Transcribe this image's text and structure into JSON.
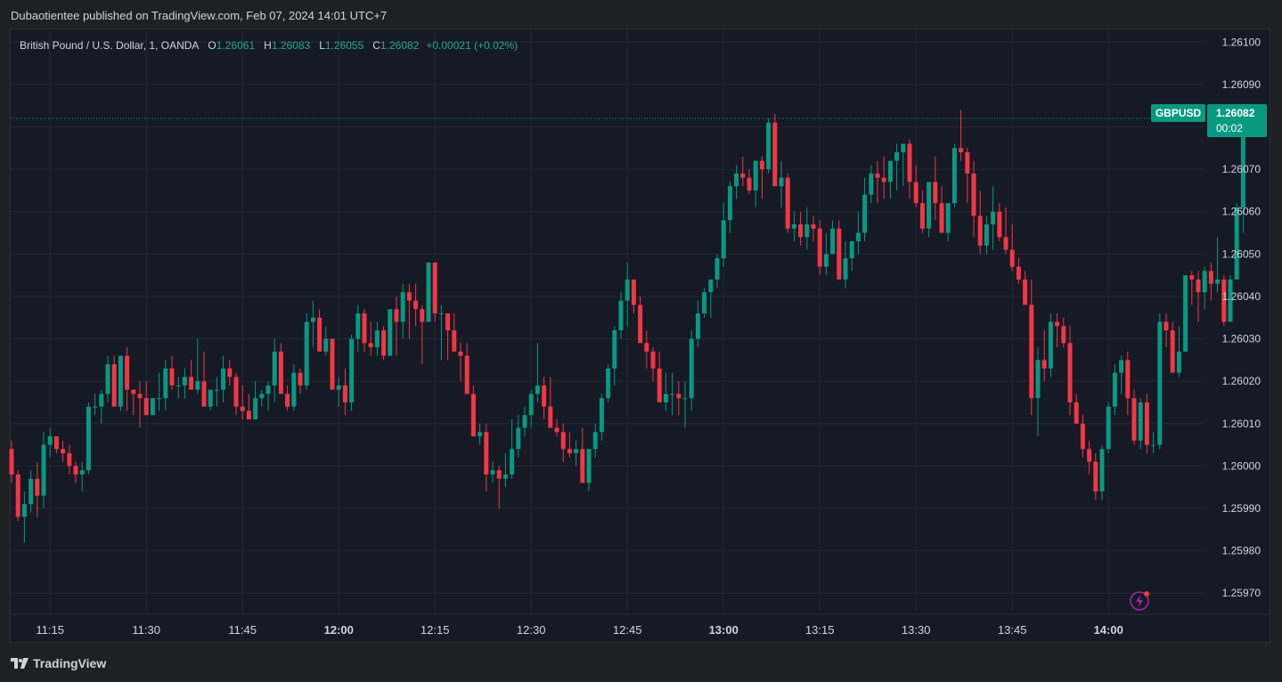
{
  "header": {
    "published": "Dubaotientee published on TradingView.com, Feb 07, 2024 14:01 UTC+7"
  },
  "legend": {
    "symbol": "British Pound / U.S. Dollar, 1, OANDA",
    "o_label": "O",
    "o_value": "1.26061",
    "h_label": "H",
    "h_value": "1.26083",
    "l_label": "L",
    "l_value": "1.26055",
    "c_label": "C",
    "c_value": "1.26082",
    "change": "+0.00021 (+0.02%)"
  },
  "price_tag": {
    "symbol": "GBPUSD",
    "price": "1.26082",
    "countdown": "00:02"
  },
  "footer": {
    "brand": "TradingView"
  },
  "colors": {
    "up": "#089981",
    "down": "#f23645",
    "grid": "#232733",
    "text": "#d1d4dc"
  },
  "icons": {
    "logo": "tradingview-logo-icon",
    "alert": "lightning-bolt-icon"
  },
  "chart_data": {
    "type": "candlestick",
    "y_axis": {
      "range": [
        1.25965,
        1.26103
      ],
      "ticks": [
        "1.26100",
        "1.26090",
        "1.26080",
        "1.26070",
        "1.26060",
        "1.26050",
        "1.26040",
        "1.26030",
        "1.26020",
        "1.26010",
        "1.26000",
        "1.25990",
        "1.25980",
        "1.25970"
      ]
    },
    "x_axis": {
      "ticks": [
        {
          "label": "11:15",
          "bold": false
        },
        {
          "label": "11:30",
          "bold": false
        },
        {
          "label": "11:45",
          "bold": false
        },
        {
          "label": "12:00",
          "bold": true
        },
        {
          "label": "12:15",
          "bold": false
        },
        {
          "label": "12:30",
          "bold": false
        },
        {
          "label": "12:45",
          "bold": false
        },
        {
          "label": "13:00",
          "bold": true
        },
        {
          "label": "13:15",
          "bold": false
        },
        {
          "label": "13:30",
          "bold": false
        },
        {
          "label": "13:45",
          "bold": false
        },
        {
          "label": "14:00",
          "bold": true
        }
      ],
      "start_time": "11:09",
      "end_time": "14:01"
    },
    "last_price": 1.26082,
    "ohlc": [
      [
        1.26004,
        1.26006,
        1.25996,
        1.25998
      ],
      [
        1.25998,
        1.25999,
        1.25987,
        1.25988
      ],
      [
        1.25988,
        1.25994,
        1.25982,
        1.25991
      ],
      [
        1.25991,
        1.25999,
        1.25989,
        1.25997
      ],
      [
        1.25997,
        1.26001,
        1.25988,
        1.25993
      ],
      [
        1.25993,
        1.26008,
        1.2599,
        1.26005
      ],
      [
        1.26005,
        1.26009,
        1.26002,
        1.26007
      ],
      [
        1.26007,
        1.26007,
        1.26003,
        1.26004
      ],
      [
        1.26004,
        1.26006,
        1.26001,
        1.26003
      ],
      [
        1.26003,
        1.26005,
        1.25998,
        1.26
      ],
      [
        1.26,
        1.26001,
        1.25996,
        1.25998
      ],
      [
        1.25998,
        1.26001,
        1.25994,
        1.25999
      ],
      [
        1.25999,
        1.26015,
        1.25998,
        1.26014
      ],
      [
        1.26014,
        1.26017,
        1.26012,
        1.26014
      ],
      [
        1.26014,
        1.26018,
        1.2601,
        1.26017
      ],
      [
        1.26017,
        1.26026,
        1.26015,
        1.26024
      ],
      [
        1.26024,
        1.26026,
        1.26016,
        1.26014
      ],
      [
        1.26014,
        1.26026,
        1.26013,
        1.26026
      ],
      [
        1.26026,
        1.26028,
        1.26013,
        1.26018
      ],
      [
        1.26018,
        1.26018,
        1.26012,
        1.26017
      ],
      [
        1.26017,
        1.2602,
        1.26009,
        1.26016
      ],
      [
        1.26016,
        1.2602,
        1.26012,
        1.26012
      ],
      [
        1.26012,
        1.26016,
        1.26012,
        1.26016
      ],
      [
        1.26016,
        1.26022,
        1.26013,
        1.26016
      ],
      [
        1.26016,
        1.26025,
        1.26013,
        1.26023
      ],
      [
        1.26023,
        1.26026,
        1.26018,
        1.26019
      ],
      [
        1.26019,
        1.26021,
        1.26016,
        1.26019
      ],
      [
        1.26019,
        1.26023,
        1.26016,
        1.26021
      ],
      [
        1.26021,
        1.26025,
        1.26018,
        1.26018
      ],
      [
        1.26018,
        1.2603,
        1.26017,
        1.2602
      ],
      [
        1.2602,
        1.26027,
        1.26016,
        1.26014
      ],
      [
        1.26014,
        1.26016,
        1.26013,
        1.26018
      ],
      [
        1.26018,
        1.26021,
        1.26014,
        1.26018
      ],
      [
        1.26018,
        1.26026,
        1.26015,
        1.26023
      ],
      [
        1.26023,
        1.26025,
        1.26019,
        1.26021
      ],
      [
        1.26021,
        1.26022,
        1.26012,
        1.26014
      ],
      [
        1.26014,
        1.26019,
        1.26011,
        1.26013
      ],
      [
        1.26013,
        1.26017,
        1.26011,
        1.26011
      ],
      [
        1.26011,
        1.2602,
        1.26011,
        1.26016
      ],
      [
        1.26016,
        1.26018,
        1.26014,
        1.26017
      ],
      [
        1.26017,
        1.2602,
        1.26013,
        1.26019
      ],
      [
        1.26019,
        1.2603,
        1.26015,
        1.26027
      ],
      [
        1.26027,
        1.26029,
        1.26018,
        1.26017
      ],
      [
        1.26017,
        1.26019,
        1.26013,
        1.26014
      ],
      [
        1.26014,
        1.26024,
        1.26013,
        1.26022
      ],
      [
        1.26022,
        1.26023,
        1.26017,
        1.26019
      ],
      [
        1.26019,
        1.26036,
        1.26018,
        1.26034
      ],
      [
        1.26034,
        1.26039,
        1.26028,
        1.26035
      ],
      [
        1.26035,
        1.26037,
        1.26028,
        1.26027
      ],
      [
        1.26027,
        1.26033,
        1.26026,
        1.2603
      ],
      [
        1.2603,
        1.2603,
        1.26018,
        1.26018
      ],
      [
        1.26018,
        1.26021,
        1.26014,
        1.26019
      ],
      [
        1.26019,
        1.26023,
        1.26012,
        1.26015
      ],
      [
        1.26015,
        1.26031,
        1.26013,
        1.2603
      ],
      [
        1.2603,
        1.26038,
        1.26027,
        1.26036
      ],
      [
        1.26036,
        1.26037,
        1.26027,
        1.26029
      ],
      [
        1.26029,
        1.26034,
        1.26026,
        1.26028
      ],
      [
        1.26028,
        1.26034,
        1.26026,
        1.26032
      ],
      [
        1.26032,
        1.26033,
        1.26025,
        1.26026
      ],
      [
        1.26026,
        1.26037,
        1.26026,
        1.26037
      ],
      [
        1.26037,
        1.2604,
        1.26026,
        1.26034
      ],
      [
        1.26034,
        1.26043,
        1.2603,
        1.26041
      ],
      [
        1.26041,
        1.26043,
        1.2603,
        1.26039
      ],
      [
        1.26039,
        1.26043,
        1.26033,
        1.26037
      ],
      [
        1.26037,
        1.26038,
        1.26024,
        1.26034
      ],
      [
        1.26034,
        1.26048,
        1.26034,
        1.26048
      ],
      [
        1.26048,
        1.26048,
        1.26034,
        1.26036
      ],
      [
        1.26036,
        1.26038,
        1.26025,
        1.26036
      ],
      [
        1.26036,
        1.26035,
        1.26025,
        1.26032
      ],
      [
        1.26032,
        1.26036,
        1.26028,
        1.26027
      ],
      [
        1.26027,
        1.26029,
        1.2602,
        1.26026
      ],
      [
        1.26026,
        1.26029,
        1.26017,
        1.26017
      ],
      [
        1.26017,
        1.26019,
        1.26008,
        1.26007
      ],
      [
        1.26007,
        1.2601,
        1.26005,
        1.26008
      ],
      [
        1.26008,
        1.2601,
        1.25994,
        1.25998
      ],
      [
        1.25998,
        1.26001,
        1.25996,
        1.25999
      ],
      [
        1.25999,
        1.26,
        1.2599,
        1.25997
      ],
      [
        1.25997,
        1.26003,
        1.25995,
        1.25998
      ],
      [
        1.25998,
        1.26011,
        1.25997,
        1.26004
      ],
      [
        1.26004,
        1.26012,
        1.26002,
        1.26009
      ],
      [
        1.26009,
        1.26014,
        1.26007,
        1.26012
      ],
      [
        1.26012,
        1.26018,
        1.26009,
        1.26017
      ],
      [
        1.26017,
        1.26029,
        1.26015,
        1.26019
      ],
      [
        1.26019,
        1.26021,
        1.26011,
        1.26014
      ],
      [
        1.26014,
        1.26021,
        1.2601,
        1.26009
      ],
      [
        1.26009,
        1.26011,
        1.26007,
        1.26008
      ],
      [
        1.26008,
        1.2601,
        1.26001,
        1.26004
      ],
      [
        1.26004,
        1.26008,
        1.26002,
        1.26003
      ],
      [
        1.26003,
        1.26006,
        1.26,
        1.26004
      ],
      [
        1.26004,
        1.26009,
        1.25998,
        1.25996
      ],
      [
        1.25996,
        1.26003,
        1.25994,
        1.26004
      ],
      [
        1.26004,
        1.2601,
        1.26002,
        1.26008
      ],
      [
        1.26008,
        1.26017,
        1.26006,
        1.26016
      ],
      [
        1.26016,
        1.26024,
        1.26015,
        1.26023
      ],
      [
        1.26023,
        1.26033,
        1.26019,
        1.26032
      ],
      [
        1.26032,
        1.26041,
        1.2603,
        1.26039
      ],
      [
        1.26039,
        1.26048,
        1.26033,
        1.26044
      ],
      [
        1.26044,
        1.26044,
        1.26036,
        1.26038
      ],
      [
        1.26038,
        1.2604,
        1.26029,
        1.26029
      ],
      [
        1.26029,
        1.26032,
        1.26023,
        1.26027
      ],
      [
        1.26027,
        1.26028,
        1.2602,
        1.26023
      ],
      [
        1.26023,
        1.26027,
        1.26015,
        1.26015
      ],
      [
        1.26015,
        1.26022,
        1.26013,
        1.26017
      ],
      [
        1.26017,
        1.26022,
        1.26012,
        1.26017
      ],
      [
        1.26017,
        1.2602,
        1.26012,
        1.26016
      ],
      [
        1.26016,
        1.2602,
        1.26009,
        1.26016
      ],
      [
        1.26016,
        1.26032,
        1.26013,
        1.2603
      ],
      [
        1.2603,
        1.26039,
        1.26028,
        1.26036
      ],
      [
        1.26036,
        1.26042,
        1.26035,
        1.26041
      ],
      [
        1.26041,
        1.26044,
        1.26035,
        1.26044
      ],
      [
        1.26044,
        1.2605,
        1.26042,
        1.26049
      ],
      [
        1.26049,
        1.26062,
        1.26047,
        1.26058
      ],
      [
        1.26058,
        1.26067,
        1.26055,
        1.26066
      ],
      [
        1.26066,
        1.26071,
        1.26063,
        1.26069
      ],
      [
        1.26069,
        1.26073,
        1.26066,
        1.26068
      ],
      [
        1.26068,
        1.2607,
        1.26064,
        1.26065
      ],
      [
        1.26065,
        1.26072,
        1.26061,
        1.26072
      ],
      [
        1.26072,
        1.26073,
        1.26063,
        1.2607
      ],
      [
        1.2607,
        1.26082,
        1.26069,
        1.26081
      ],
      [
        1.26081,
        1.26083,
        1.26066,
        1.26066
      ],
      [
        1.26066,
        1.26072,
        1.26061,
        1.26068
      ],
      [
        1.26068,
        1.26069,
        1.26055,
        1.26056
      ],
      [
        1.26056,
        1.2606,
        1.26053,
        1.26057
      ],
      [
        1.26057,
        1.2606,
        1.26052,
        1.26054
      ],
      [
        1.26054,
        1.26061,
        1.26051,
        1.26057
      ],
      [
        1.26057,
        1.26059,
        1.26053,
        1.26056
      ],
      [
        1.26056,
        1.26058,
        1.26045,
        1.26047
      ],
      [
        1.26047,
        1.26055,
        1.26045,
        1.2605
      ],
      [
        1.2605,
        1.26058,
        1.2605,
        1.26056
      ],
      [
        1.26056,
        1.26058,
        1.26045,
        1.26044
      ],
      [
        1.26044,
        1.26053,
        1.26042,
        1.26049
      ],
      [
        1.26049,
        1.26053,
        1.26046,
        1.26053
      ],
      [
        1.26053,
        1.2606,
        1.2605,
        1.26055
      ],
      [
        1.26055,
        1.26068,
        1.26053,
        1.26064
      ],
      [
        1.26064,
        1.26071,
        1.26062,
        1.26069
      ],
      [
        1.26069,
        1.26072,
        1.26062,
        1.26068
      ],
      [
        1.26068,
        1.26073,
        1.26063,
        1.26067
      ],
      [
        1.26067,
        1.26072,
        1.26063,
        1.26072
      ],
      [
        1.26072,
        1.26076,
        1.26065,
        1.26074
      ],
      [
        1.26074,
        1.26076,
        1.26066,
        1.26076
      ],
      [
        1.26076,
        1.26077,
        1.26063,
        1.26067
      ],
      [
        1.26067,
        1.26071,
        1.26061,
        1.26062
      ],
      [
        1.26062,
        1.26065,
        1.26055,
        1.26056
      ],
      [
        1.26056,
        1.26065,
        1.26054,
        1.26067
      ],
      [
        1.26067,
        1.26073,
        1.26058,
        1.26062
      ],
      [
        1.26062,
        1.26066,
        1.26059,
        1.26055
      ],
      [
        1.26055,
        1.2606,
        1.26053,
        1.26062
      ],
      [
        1.26062,
        1.26076,
        1.26061,
        1.26075
      ],
      [
        1.26075,
        1.26084,
        1.26072,
        1.26074
      ],
      [
        1.26074,
        1.26075,
        1.26062,
        1.26069
      ],
      [
        1.26069,
        1.26072,
        1.26054,
        1.26059
      ],
      [
        1.26059,
        1.26065,
        1.2605,
        1.26052
      ],
      [
        1.26052,
        1.26059,
        1.2605,
        1.26057
      ],
      [
        1.26057,
        1.26066,
        1.26051,
        1.2606
      ],
      [
        1.2606,
        1.26062,
        1.26053,
        1.26054
      ],
      [
        1.26054,
        1.26061,
        1.2605,
        1.26051
      ],
      [
        1.26051,
        1.26057,
        1.26046,
        1.26047
      ],
      [
        1.26047,
        1.26049,
        1.26043,
        1.26044
      ],
      [
        1.26044,
        1.26046,
        1.26038,
        1.26038
      ],
      [
        1.26038,
        1.26044,
        1.26012,
        1.26016
      ],
      [
        1.26016,
        1.26028,
        1.26007,
        1.26025
      ],
      [
        1.26025,
        1.26032,
        1.2602,
        1.26023
      ],
      [
        1.26023,
        1.26036,
        1.26021,
        1.26034
      ],
      [
        1.26034,
        1.26036,
        1.26028,
        1.26033
      ],
      [
        1.26033,
        1.26035,
        1.26028,
        1.26029
      ],
      [
        1.26029,
        1.26033,
        1.26012,
        1.26015
      ],
      [
        1.26015,
        1.26017,
        1.2601,
        1.2601
      ],
      [
        1.2601,
        1.26012,
        1.26002,
        1.26004
      ],
      [
        1.26004,
        1.26006,
        1.25998,
        1.26001
      ],
      [
        1.26001,
        1.26003,
        1.25992,
        1.25994
      ],
      [
        1.25994,
        1.26005,
        1.25992,
        1.26004
      ],
      [
        1.26004,
        1.26015,
        1.26003,
        1.26014
      ],
      [
        1.26014,
        1.26024,
        1.26012,
        1.26022
      ],
      [
        1.26022,
        1.26026,
        1.26017,
        1.26025
      ],
      [
        1.26025,
        1.26027,
        1.26012,
        1.26016
      ],
      [
        1.26016,
        1.26018,
        1.26005,
        1.26006
      ],
      [
        1.26006,
        1.26016,
        1.26004,
        1.26015
      ],
      [
        1.26015,
        1.26017,
        1.26003,
        1.26005
      ],
      [
        1.26005,
        1.26008,
        1.26003,
        1.26005
      ],
      [
        1.26005,
        1.26036,
        1.26004,
        1.26034
      ],
      [
        1.26034,
        1.26036,
        1.26028,
        1.26032
      ],
      [
        1.26032,
        1.26034,
        1.26022,
        1.26022
      ],
      [
        1.26022,
        1.26033,
        1.26021,
        1.26027
      ],
      [
        1.26027,
        1.26045,
        1.26027,
        1.26045
      ],
      [
        1.26045,
        1.26046,
        1.26038,
        1.26044
      ],
      [
        1.26044,
        1.26046,
        1.26034,
        1.26041
      ],
      [
        1.26041,
        1.26047,
        1.26037,
        1.26046
      ],
      [
        1.26046,
        1.26048,
        1.26039,
        1.26043
      ],
      [
        1.26043,
        1.26054,
        1.26041,
        1.26044
      ],
      [
        1.26044,
        1.26045,
        1.26033,
        1.26034
      ],
      [
        1.26034,
        1.26045,
        1.26034,
        1.26044
      ],
      [
        1.26044,
        1.26062,
        1.26044,
        1.26061
      ],
      [
        1.26061,
        1.26083,
        1.26055,
        1.26082
      ]
    ]
  }
}
